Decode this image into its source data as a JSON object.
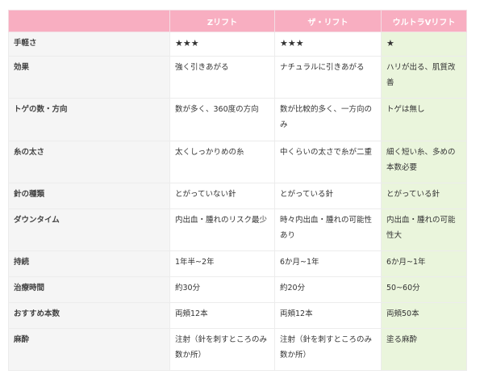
{
  "table": {
    "header": [
      "",
      "Zリフト",
      "ザ・リフト",
      "ウルトラVリフト"
    ],
    "rows": [
      {
        "label": "手軽さ",
        "cells": [
          "★★★",
          "★★★",
          "★"
        ]
      },
      {
        "label": "効果",
        "cells": [
          "強く引きあがる",
          "ナチュラルに引きあがる",
          "ハリが出る、肌質改善"
        ]
      },
      {
        "label": "トゲの数・方向",
        "cells": [
          "数が多く、360度の方向",
          "数が比較的多く、一方向のみ",
          "トゲは無し"
        ]
      },
      {
        "label": "糸の太さ",
        "cells": [
          "太くしっかりめの糸",
          "中くらいの太さで糸が二重",
          "細く短い糸、多めの本数必要"
        ]
      },
      {
        "label": "針の種類",
        "cells": [
          "とがっていない針",
          "とがっている針",
          "とがっている針"
        ]
      },
      {
        "label": "ダウンタイム",
        "cells": [
          "内出血・腫れのリスク最少",
          "時々内出血・腫れの可能性あり",
          "内出血・腫れの可能性大"
        ]
      },
      {
        "label": "持続",
        "cells": [
          "1年半~2年",
          "6か月~1年",
          "6か月~1年"
        ]
      },
      {
        "label": "治療時間",
        "cells": [
          "約30分",
          "約20分",
          "50~60分"
        ]
      },
      {
        "label": "おすすめ本数",
        "cells": [
          "両頬12本",
          "両頬12本",
          "両頬50本"
        ]
      },
      {
        "label": "麻酔",
        "cells": [
          "注射（針を刺すところのみ数か所）",
          "注射（針を刺すところのみ数か所）",
          "塗る麻酔"
        ]
      }
    ]
  },
  "colors": {
    "header_bg": "#f8aec1",
    "label_bg": "#f5f5f5",
    "ultra_col_bg": "#eaf5dc"
  }
}
